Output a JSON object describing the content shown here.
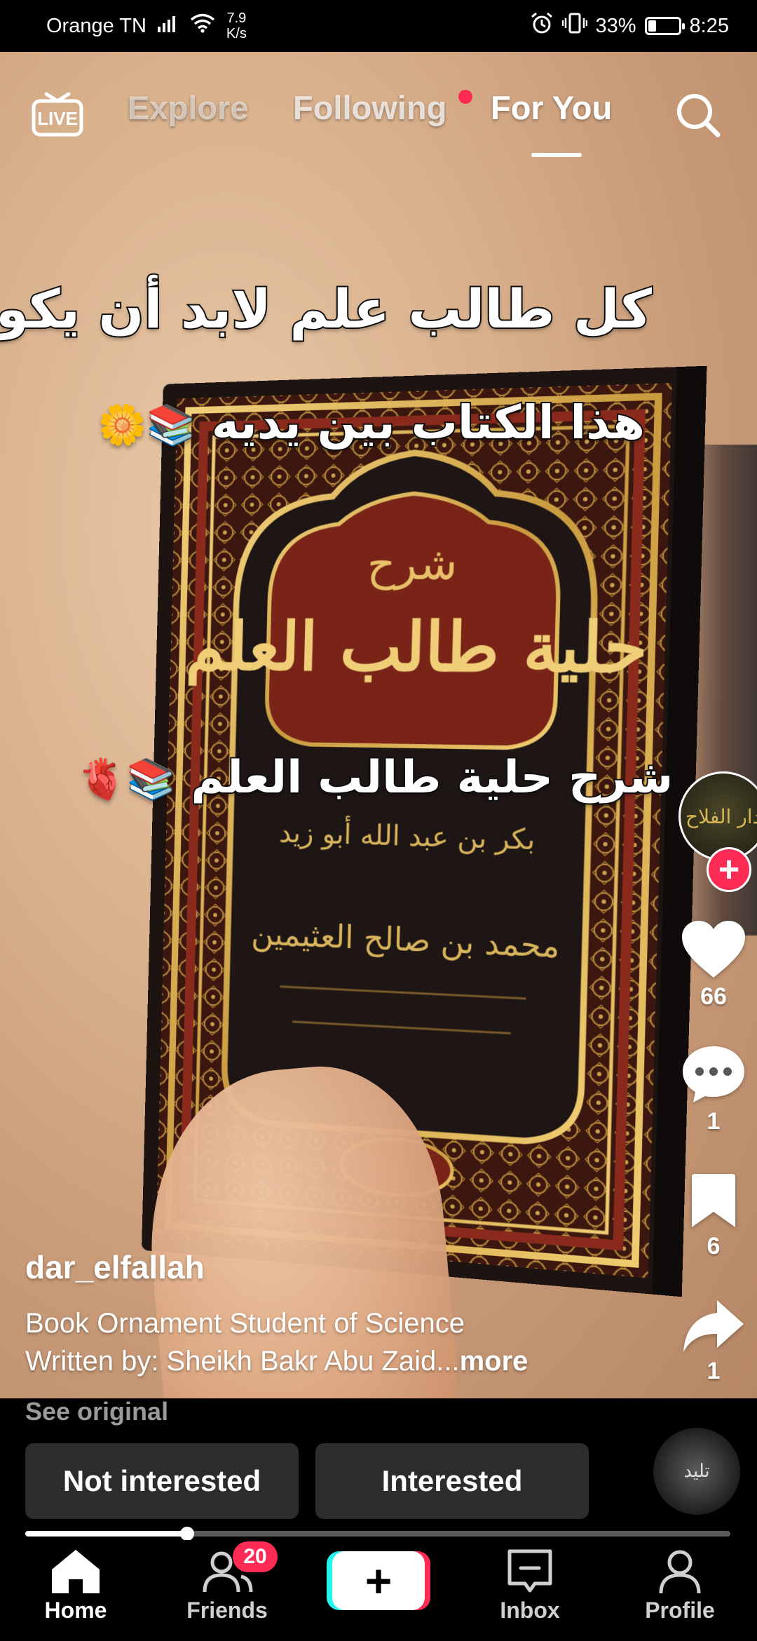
{
  "status_bar": {
    "carrier": "Orange TN",
    "net_speed_value": "7.9",
    "net_speed_unit": "K/s",
    "battery": "33%",
    "battery_level": 0.33,
    "time": "8:25"
  },
  "top_nav": {
    "live_label": "LIVE",
    "tabs": [
      "Explore",
      "Following",
      "For You"
    ],
    "active_tab": "For You"
  },
  "video": {
    "caption_line1": "كل طالب علم لابد أن يكون",
    "caption_line2": "هذا الكتاب بين يديه",
    "caption_line3": "شرح حلية طالب العلم",
    "book_title_small": "شرح",
    "book_title_main": "حلية طالب العلم",
    "book_author": "بكر بن عبد الله أبو زيد",
    "book_explainer": "محمد بن صالح العثيمين"
  },
  "creator": {
    "avatar_text": "دار الفلاح",
    "username": "dar_elfallah",
    "description_line1": "Book Ornament Student of Science",
    "description_line2": "Written by: Sheikh Bakr Abu Zaid...",
    "more_label": "more",
    "see_original": "See original"
  },
  "actions": {
    "likes": "66",
    "comments": "1",
    "saves": "6",
    "shares": "1"
  },
  "interest": {
    "not_interested": "Not interested",
    "interested": "Interested",
    "disc_text": "تليد"
  },
  "playback": {
    "progress": 0.23
  },
  "bottom_nav": {
    "home": "Home",
    "friends": "Friends",
    "friends_badge": "20",
    "create": "+",
    "inbox": "Inbox",
    "profile": "Profile"
  },
  "colors": {
    "accent": "#fe2c55",
    "cyan": "#25f4ee"
  }
}
